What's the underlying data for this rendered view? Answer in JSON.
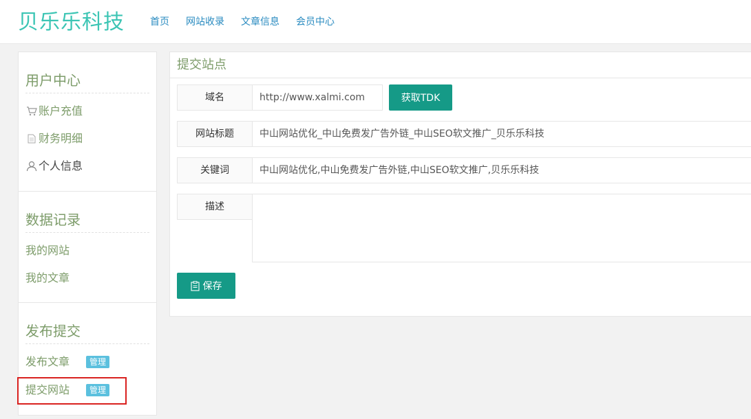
{
  "header": {
    "logo": "贝乐乐科技",
    "nav": [
      "首页",
      "网站收录",
      "文章信息",
      "会员中心"
    ]
  },
  "sidebar": {
    "groups": [
      {
        "title": "用户中心",
        "items": [
          {
            "label": "账户充值",
            "icon": "cart-icon"
          },
          {
            "label": "财务明细",
            "icon": "document-icon"
          },
          {
            "label": "个人信息",
            "icon": "user-icon"
          }
        ]
      },
      {
        "title": "数据记录",
        "items": [
          {
            "label": "我的网站"
          },
          {
            "label": "我的文章"
          }
        ]
      },
      {
        "title": "发布提交",
        "items": [
          {
            "label": "发布文章",
            "badge": "管理"
          },
          {
            "label": "提交网站",
            "badge": "管理"
          }
        ]
      }
    ]
  },
  "form": {
    "title": "提交站点",
    "domain_label": "域名",
    "domain_placeholder": "http://www.xalmi.com",
    "fetch_button": "获取TDK",
    "title_label": "网站标题",
    "title_value": "中山网站优化_中山免费发广告外链_中山SEO软文推广_贝乐乐科技",
    "keywords_label": "关键词",
    "keywords_value": "中山网站优化,中山免费发广告外链,中山SEO软文推广,贝乐乐科技",
    "desc_label": "描述",
    "desc_value": "",
    "save_button": "保存"
  },
  "colors": {
    "logo": "#3cc5b4",
    "nav": "#2a8bc0",
    "sidebar_text": "#7d9c6a",
    "button": "#159a87",
    "badge": "#5bc0de",
    "highlight": "#d9201e"
  }
}
